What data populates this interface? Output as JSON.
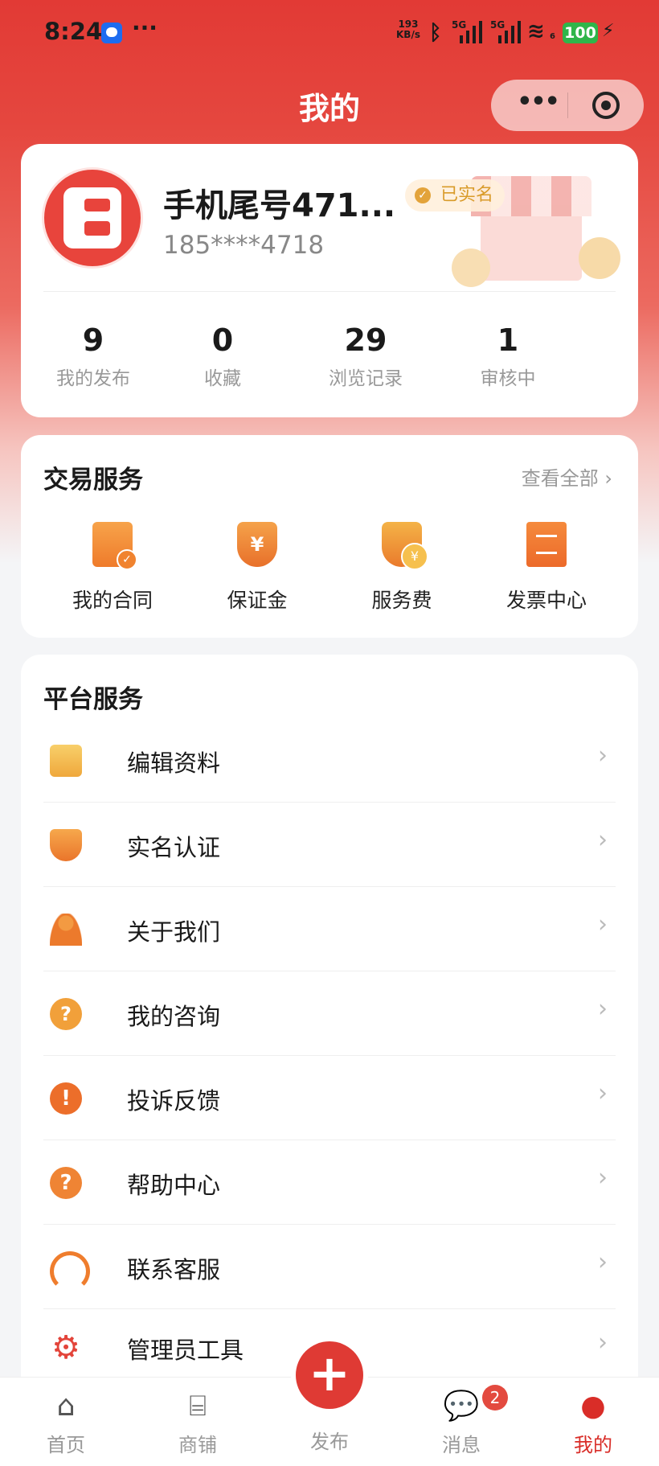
{
  "status_bar": {
    "time": "8:24",
    "more": "···",
    "net_speed_value": "193",
    "net_speed_unit": "KB/s",
    "sim1": "5G",
    "sim2": "5G",
    "wifi_badge": "6",
    "battery": "100"
  },
  "nav": {
    "title": "我的",
    "more_label": "•••"
  },
  "profile": {
    "name": "手机尾号471...",
    "verified_label": "已实名",
    "phone": "185****4718",
    "stats": [
      {
        "value": "9",
        "label": "我的发布"
      },
      {
        "value": "0",
        "label": "收藏"
      },
      {
        "value": "29",
        "label": "浏览记录"
      },
      {
        "value": "1",
        "label": "审核中"
      }
    ]
  },
  "trade_services": {
    "title": "交易服务",
    "view_all": "查看全部 ›",
    "items": [
      {
        "label": "我的合同",
        "icon": "contract-icon"
      },
      {
        "label": "保证金",
        "icon": "deposit-shield-icon"
      },
      {
        "label": "服务费",
        "icon": "service-fee-icon"
      },
      {
        "label": "发票中心",
        "icon": "invoice-icon"
      }
    ]
  },
  "platform_services": {
    "title": "平台服务",
    "items": [
      {
        "label": "编辑资料",
        "icon": "edit-profile-icon"
      },
      {
        "label": "实名认证",
        "icon": "verify-shield-icon"
      },
      {
        "label": "关于我们",
        "icon": "person-icon"
      },
      {
        "label": "我的咨询",
        "icon": "consult-bubble-icon"
      },
      {
        "label": "投诉反馈",
        "icon": "complaint-icon"
      },
      {
        "label": "帮助中心",
        "icon": "help-icon"
      },
      {
        "label": "联系客服",
        "icon": "headset-icon"
      },
      {
        "label": "管理员工具",
        "icon": "gear-icon"
      }
    ]
  },
  "tabbar": {
    "items": [
      {
        "label": "首页",
        "icon": "home-icon"
      },
      {
        "label": "商铺",
        "icon": "shop-icon"
      },
      {
        "label": "发布",
        "icon": "plus-icon"
      },
      {
        "label": "消息",
        "icon": "message-icon",
        "badge": "2"
      },
      {
        "label": "我的",
        "icon": "user-icon",
        "active": true
      }
    ]
  },
  "colors": {
    "brand_red": "#e23a35",
    "accent_orange": "#ef7d2d",
    "active_tab": "#d92d28"
  }
}
